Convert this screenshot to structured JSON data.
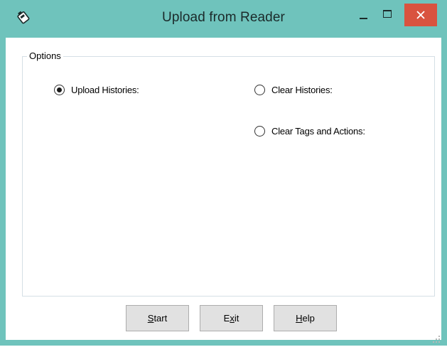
{
  "window": {
    "title": "Upload from Reader",
    "icon": "reader-app-icon",
    "controls": [
      "minimize-icon",
      "maximize-icon",
      "close-icon"
    ],
    "colors": {
      "titlebar": "#6fc3bc",
      "close_button": "#d9533f"
    }
  },
  "options": {
    "legend": "Options",
    "radios": [
      {
        "label": "Upload Histories:",
        "selected": true
      },
      {
        "label": "Clear Histories:",
        "selected": false
      },
      {
        "label": "Clear Tags and Actions:",
        "selected": false
      }
    ]
  },
  "buttons": {
    "start": {
      "mnemonic": "S",
      "rest": "tart"
    },
    "exit": {
      "pre": "E",
      "mnemonic": "x",
      "rest": "it"
    },
    "help": {
      "mnemonic": "H",
      "rest": "elp"
    }
  }
}
